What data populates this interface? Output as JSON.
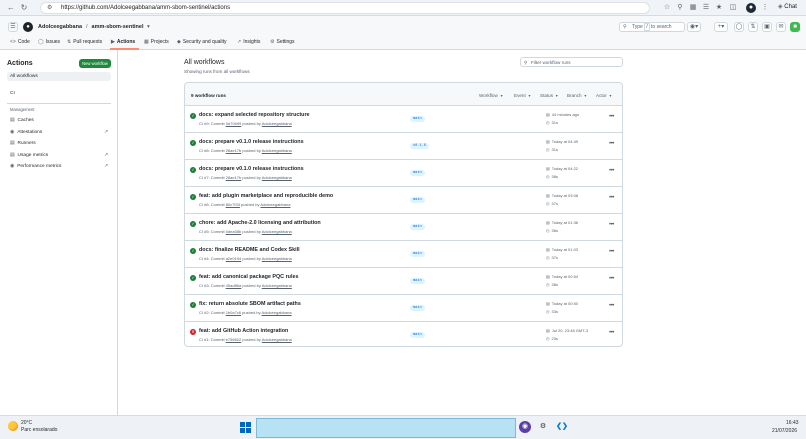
{
  "browser": {
    "url": "https://github.com/Adolceegabbana/amm-sbom-sentinel/actions",
    "chat_label": "Chat"
  },
  "header": {
    "owner": "Adolceegabbana",
    "separator": "/",
    "repo": "amm-sbom-sentinel",
    "search_placeholder_prefix": "Type",
    "search_key": "/",
    "search_placeholder_suffix": "to search"
  },
  "repo_tabs": [
    {
      "label": "Code",
      "icon": "code-icon"
    },
    {
      "label": "Issues",
      "icon": "issue-icon"
    },
    {
      "label": "Pull requests",
      "icon": "pull-request-icon"
    },
    {
      "label": "Actions",
      "icon": "play-icon"
    },
    {
      "label": "Projects",
      "icon": "table-icon"
    },
    {
      "label": "Security and quality",
      "icon": "shield-icon"
    },
    {
      "label": "Insights",
      "icon": "graph-icon"
    },
    {
      "label": "Settings",
      "icon": "gear-icon"
    }
  ],
  "sidebar": {
    "title": "Actions",
    "new_workflow": "New workflow",
    "all_workflows": "All workflows",
    "ci": "CI",
    "management_label": "Management",
    "management_items": [
      {
        "label": "Caches",
        "external": false
      },
      {
        "label": "Attestations",
        "external": true
      },
      {
        "label": "Runners",
        "external": false
      },
      {
        "label": "Usage metrics",
        "external": true
      },
      {
        "label": "Performance metrics",
        "external": true
      }
    ]
  },
  "main": {
    "title": "All workflows",
    "subtitle": "Showing runs from all workflows",
    "filter_placeholder": "Filter workflow runs",
    "runs_count": "9 workflow runs",
    "filters": [
      "Workflow",
      "Event",
      "Status",
      "Branch",
      "Actor"
    ],
    "runs": [
      {
        "title": "docs: expand selected repository structure",
        "meta_prefix": "CI #9: Commit",
        "commit": "0d70b99",
        "pushed_by": "pushed by",
        "actor": "Adolceegabbana",
        "branch": "main",
        "date": "44 minutes ago",
        "duration": "31s",
        "status": "success"
      },
      {
        "title": "docs: prepare v0.1.0 release instructions",
        "meta_prefix": "CI #8: Commit",
        "commit": "28ae17b",
        "pushed_by": "pushed by",
        "actor": "Adolceegabbana",
        "branch": "v0.1.0",
        "date": "Today at 04:49",
        "duration": "31s",
        "status": "success"
      },
      {
        "title": "docs: prepare v0.1.0 release instructions",
        "meta_prefix": "CI #7: Commit",
        "commit": "28ae17b",
        "pushed_by": "pushed by",
        "actor": "Adolceegabbana",
        "branch": "main",
        "date": "Today at 04:22",
        "duration": "38s",
        "status": "success"
      },
      {
        "title": "feat: add plugin marketplace and reproducible demo",
        "meta_prefix": "CI #6: Commit",
        "commit": "80c7f33",
        "pushed_by": "pushed by",
        "actor": "Adolceegabbana",
        "branch": "main",
        "date": "Today at 03:08",
        "duration": "37s",
        "status": "success"
      },
      {
        "title": "chore: add Apache-2.0 licensing and attribution",
        "meta_prefix": "CI #5: Commit",
        "commit": "0dea08b",
        "pushed_by": "pushed by",
        "actor": "Adolceegabbana",
        "branch": "main",
        "date": "Today at 01:36",
        "duration": "36s",
        "status": "success"
      },
      {
        "title": "docs: finalize README and Codex Skill",
        "meta_prefix": "CI #4: Commit",
        "commit": "a2e0194",
        "pushed_by": "pushed by",
        "actor": "Adolceegabbana",
        "branch": "main",
        "date": "Today at 01:03",
        "duration": "37s",
        "status": "success"
      },
      {
        "title": "feat: add canonical package PQC rules",
        "meta_prefix": "CI #3: Commit",
        "commit": "45ad86a",
        "pushed_by": "pushed by",
        "actor": "Adolceegabbana",
        "branch": "main",
        "date": "Today at 00:54",
        "duration": "38s",
        "status": "success"
      },
      {
        "title": "fix: return absolute SBOM artifact paths",
        "meta_prefix": "CI #2: Commit",
        "commit": "1b0a7c6",
        "pushed_by": "pushed by",
        "actor": "Adolceegabbana",
        "branch": "main",
        "date": "Today at 00:50",
        "duration": "33s",
        "status": "success"
      },
      {
        "title": "feat: add GitHub Action integration",
        "meta_prefix": "CI #1: Commit",
        "commit": "e756602",
        "pushed_by": "pushed by",
        "actor": "Adolceegabbana",
        "branch": "main",
        "date": "Jul 20, 23:48 GMT-3",
        "duration": "23s",
        "status": "failure"
      }
    ]
  },
  "taskbar": {
    "temperature": "20°C",
    "weather": "Parc ensolarado",
    "time": "16:43",
    "date": "21/07/2026"
  },
  "colors": {
    "success": "#1a7f37",
    "failure": "#d1242f",
    "accent_underline": "#fd8c73",
    "new_button": "#1f883d"
  }
}
